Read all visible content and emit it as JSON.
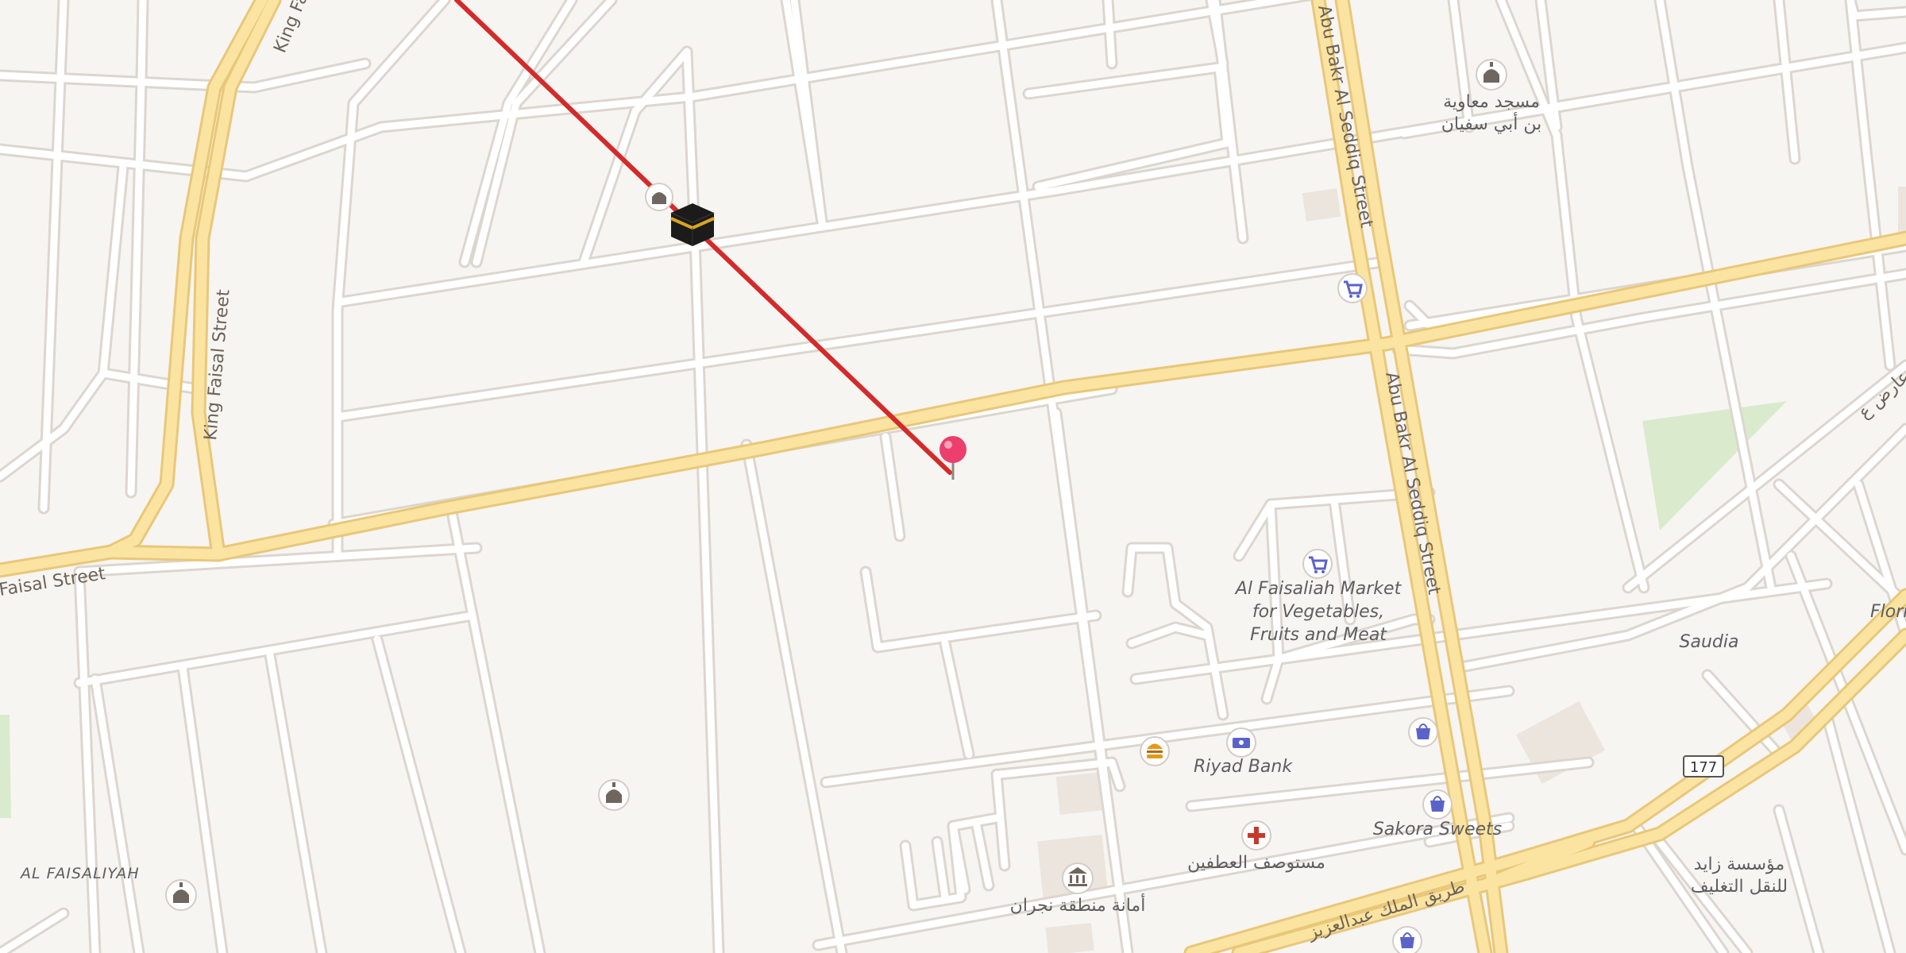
{
  "colors": {
    "background": "#f7f5f2",
    "street_fill": "#ffffff",
    "street_casing": "#dcd6cf",
    "major_road_fill": "#fbe4a1",
    "major_road_casing": "#e9c77a",
    "route_line": "#d42a2a",
    "park": "#d9ebcc",
    "building": "#ece6df",
    "pin": "#ec3f6d",
    "poi_icon": "#5b63c9"
  },
  "roads": {
    "king_faisal_h": "Faisal Street",
    "king_faisal_v": "King Faisal Street",
    "king_faisal_top": "King Fa",
    "abu_bakr_upper": "Abu Bakr Al Seddiq Street",
    "abu_bakr_lower": "Abu Bakr Al Seddiq Street",
    "king_abdulaziz": "طريق الملك عبدالعزيز",
    "shield_177": "177",
    "right_edge_ar": "عارض ع"
  },
  "places": {
    "mosque_muawiya_line1": "مسجد معاوية",
    "mosque_muawiya_line2": "بن أبي سفيان",
    "market_line1": "Al Faisaliah Market",
    "market_line2": "for Vegetables,",
    "market_line3": "Fruits and Meat",
    "riyad_bank": "Riyad Bank",
    "sakora_sweets": "Sakora Sweets",
    "saudia": "Saudia",
    "flori": "Flori",
    "dispensary_ar": "مستوصف العطفين",
    "najran_ar": "أمانة منطقة نجران",
    "transport_line1": "مؤسسة زايد",
    "transport_line2": "للنقل التغليف",
    "district": "AL FAISALIYAH"
  },
  "icons": {
    "kaaba": "kaaba-icon",
    "pin": "map-pin-icon",
    "mosque": "mosque-icon",
    "shopping_cart": "shopping-cart-icon",
    "shopping_bag": "shopping-bag-icon",
    "bank": "bank-icon",
    "food": "burger-icon",
    "medical": "medical-cross-icon",
    "government": "government-building-icon"
  }
}
